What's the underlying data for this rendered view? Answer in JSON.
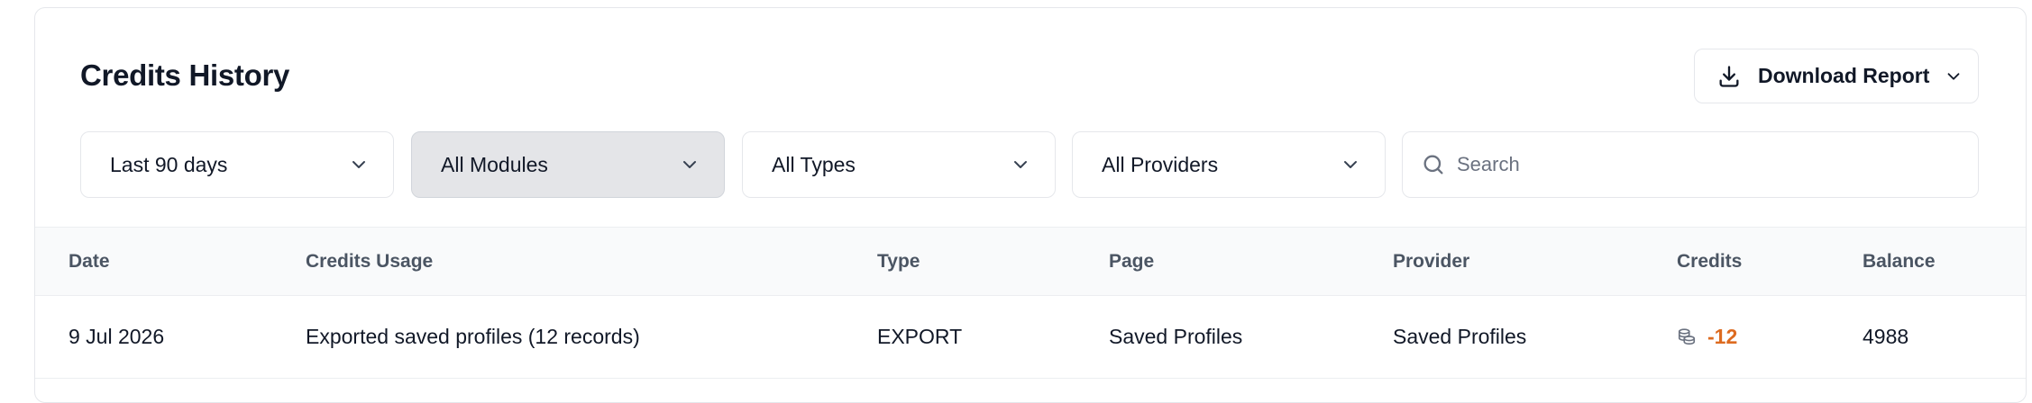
{
  "header": {
    "title": "Credits History",
    "download_label": "Download Report"
  },
  "filters": [
    {
      "label": "Last 90 days",
      "active": false
    },
    {
      "label": "All Modules",
      "active": true
    },
    {
      "label": "All Types",
      "active": false
    },
    {
      "label": "All Providers",
      "active": false
    }
  ],
  "search": {
    "placeholder": "Search",
    "value": ""
  },
  "table": {
    "columns": [
      "Date",
      "Credits Usage",
      "Type",
      "Page",
      "Provider",
      "Credits",
      "Balance"
    ],
    "rows": [
      {
        "date": "9 Jul 2026",
        "usage": "Exported saved profiles (12 records)",
        "type": "EXPORT",
        "page": "Saved Profiles",
        "provider": "Saved Profiles",
        "credits": "-12",
        "balance": "4988"
      }
    ]
  },
  "colors": {
    "negative_credits": "#dd6b20",
    "active_filter_bg": "#e4e5e8",
    "header_bg": "#f9fafb"
  },
  "icons": {
    "download": "download-icon",
    "chevron": "chevron-down-icon",
    "search": "search-icon",
    "coins": "coins-icon"
  }
}
